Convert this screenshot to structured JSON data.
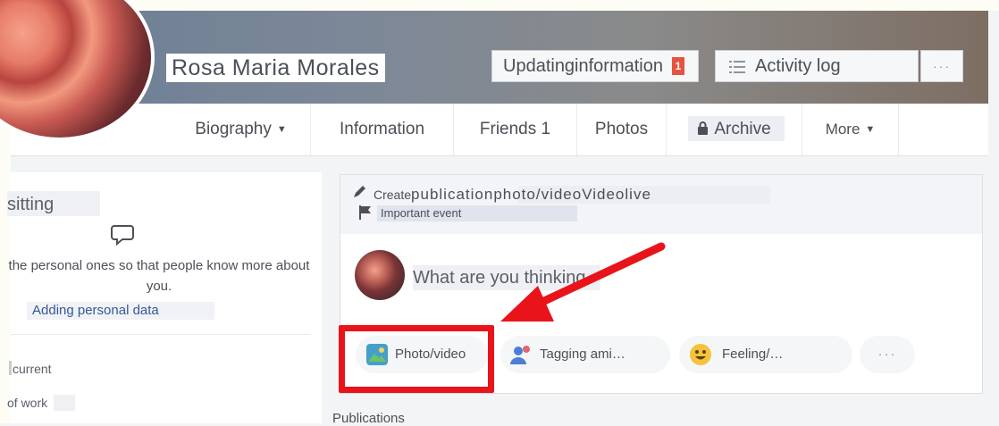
{
  "profile": {
    "name": "Rosa Maria Morales",
    "update_button_label": "Updatinginformation",
    "update_badge": "1",
    "activity_log_label": "Activity log",
    "more_dots": "···"
  },
  "tabs": [
    {
      "label": "Biography",
      "caret": "▼"
    },
    {
      "label": "Information"
    },
    {
      "label": "Friends 1"
    },
    {
      "label": "Photos"
    },
    {
      "label": "Archive",
      "icon": "lock-icon"
    },
    {
      "label": "More",
      "caret": "▼"
    }
  ],
  "left_card": {
    "title": "sitting",
    "text": "the personal ones so that people know more about you.",
    "link": "Adding personal data",
    "current": "current",
    "of_work": "of work"
  },
  "composer": {
    "create_prefix": "Create",
    "create_types": "publicationphoto/videoVideolive",
    "important_event": "Important event",
    "placeholder": "What are you thinking",
    "actions": [
      {
        "label": "Photo/video",
        "icon": "photo-icon"
      },
      {
        "label": "Tagging ami…",
        "icon": "tag-friends-icon"
      },
      {
        "label": "Feeling/…",
        "icon": "feeling-emoji-icon"
      },
      {
        "label": "···",
        "icon": "more-dots-icon"
      }
    ]
  },
  "publications_label": "Publications",
  "colors": {
    "highlight_red": "#e8141a",
    "link_blue": "#365899",
    "badge_red": "#e8533f"
  }
}
